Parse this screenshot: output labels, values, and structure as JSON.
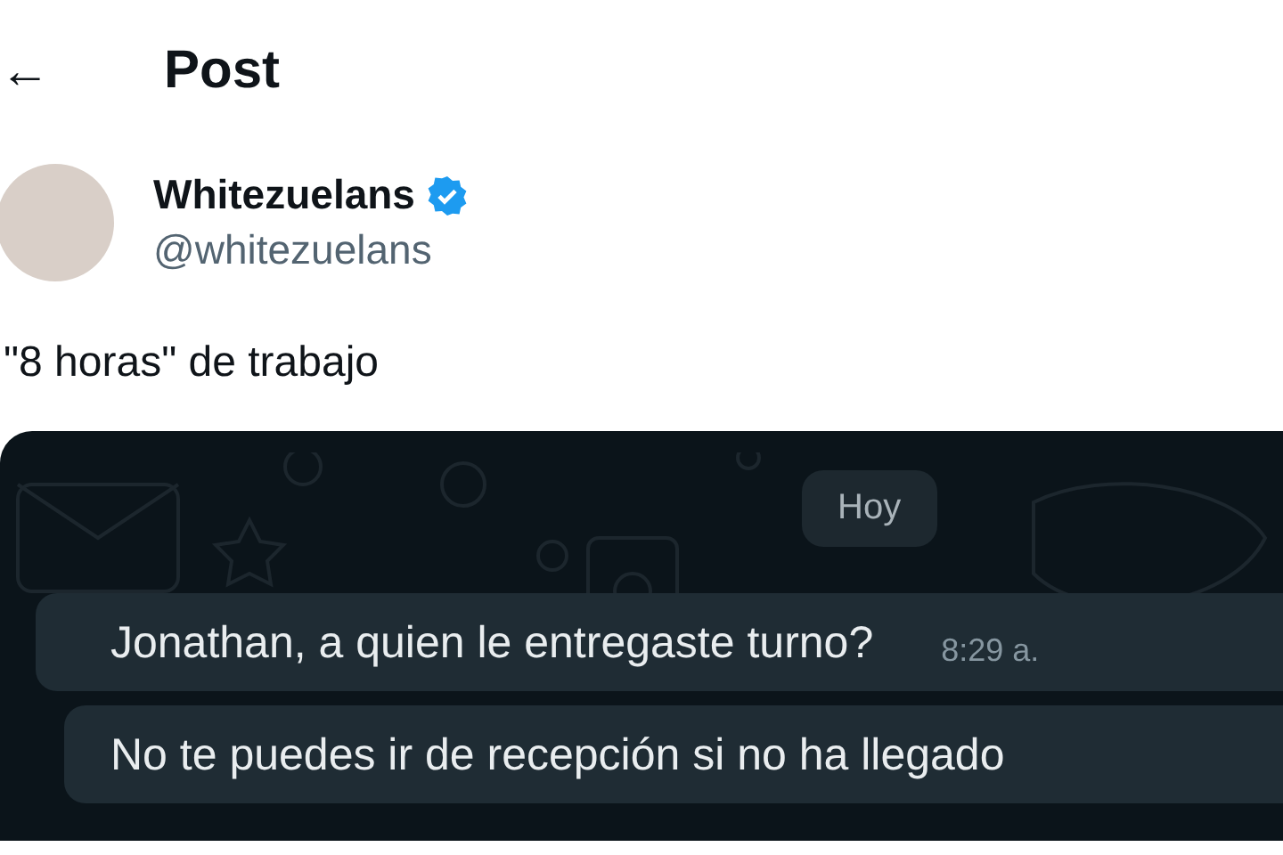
{
  "header": {
    "back": "←",
    "title": "Post"
  },
  "author": {
    "name": "Whitezuelans",
    "verified": true,
    "handle": "@whitezuelans"
  },
  "post_text": "\"8 horas\" de trabajo",
  "chat": {
    "date_chip": "Hoy",
    "messages": [
      {
        "text": "Jonathan, a quien le entregaste turno?",
        "time": "8:29 a."
      },
      {
        "text": "No te puedes ir de recepción si no ha llegado"
      }
    ]
  }
}
